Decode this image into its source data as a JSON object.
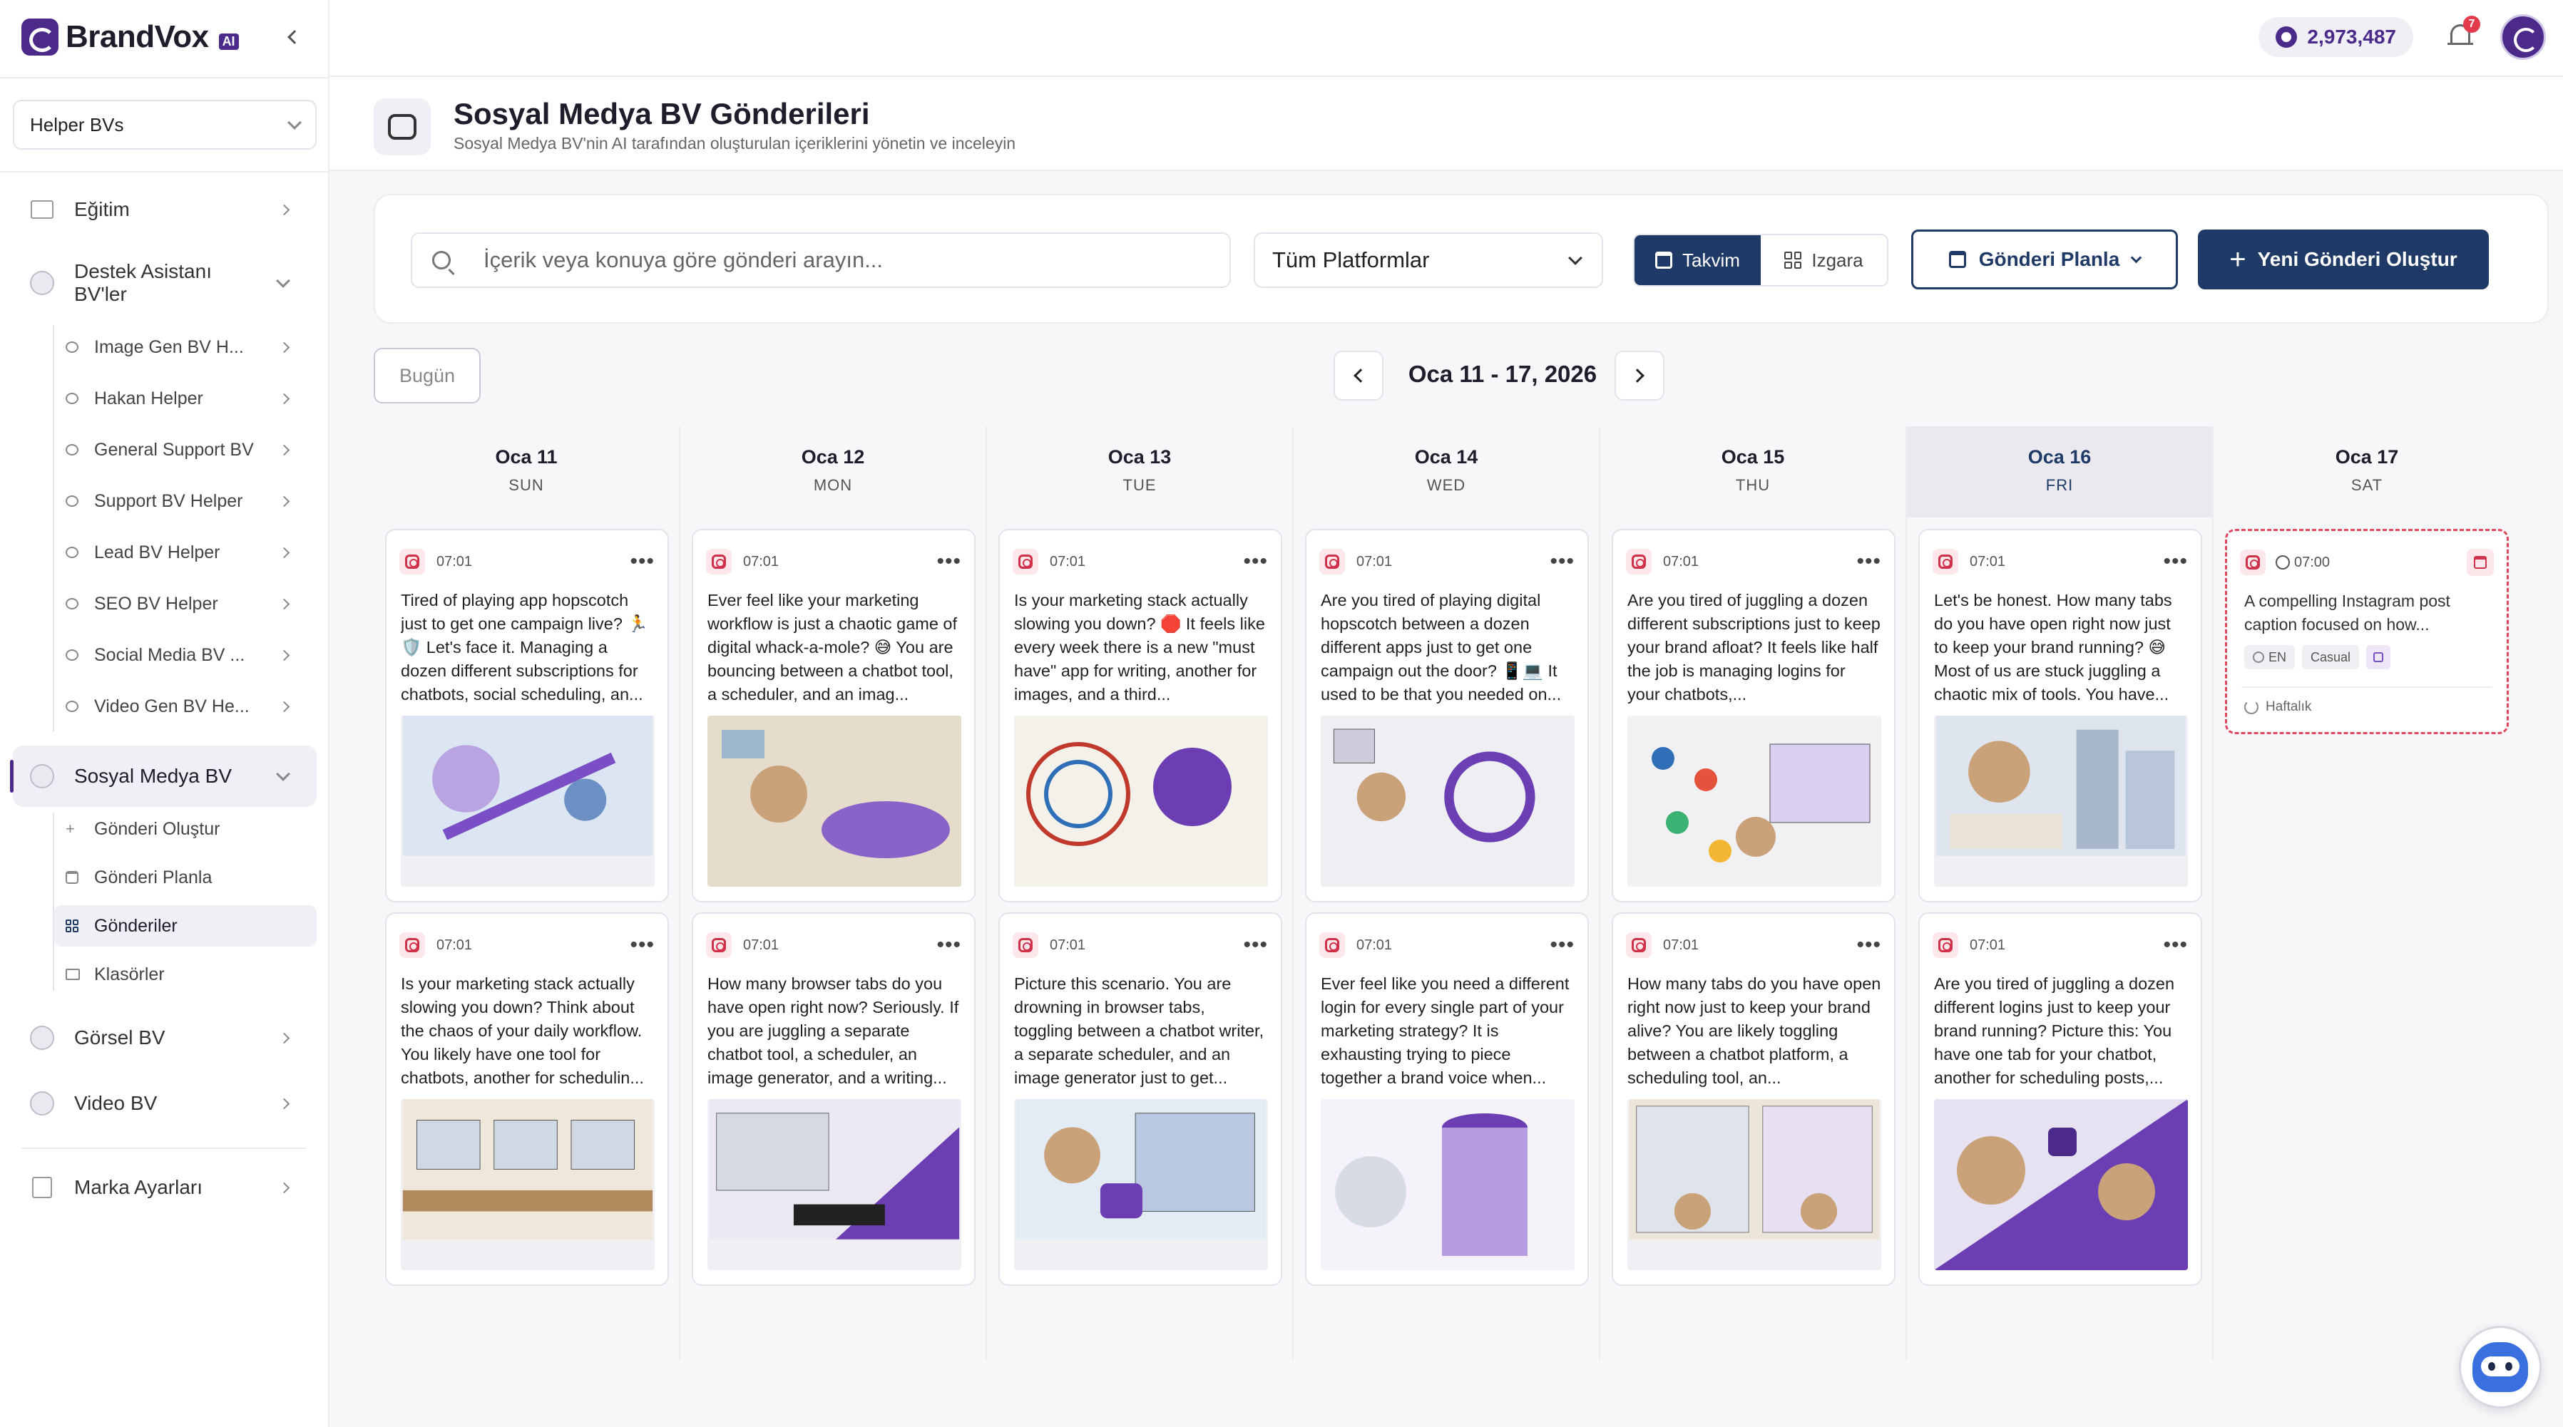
{
  "brand": {
    "name": "BrandVox",
    "badge": "AI",
    "accent": "#4b2a8a"
  },
  "sidebar": {
    "selector": "Helper BVs",
    "items": [
      {
        "label": "Eğitim",
        "icon": "book-icon"
      },
      {
        "label": "Destek Asistanı BV'ler",
        "icon": "bot-icon"
      },
      {
        "label": "Sosyal Medya BV",
        "icon": "bot-icon"
      },
      {
        "label": "Görsel BV",
        "icon": "bot-icon"
      },
      {
        "label": "Video BV",
        "icon": "bot-icon"
      },
      {
        "label": "Marka Ayarları",
        "icon": "building-icon"
      }
    ],
    "support_sub": [
      {
        "label": "Image Gen BV H..."
      },
      {
        "label": "Hakan Helper"
      },
      {
        "label": "General Support BV"
      },
      {
        "label": "Support BV Helper"
      },
      {
        "label": "Lead BV Helper"
      },
      {
        "label": "SEO BV Helper"
      },
      {
        "label": "Social Media BV ..."
      },
      {
        "label": "Video Gen BV He..."
      }
    ],
    "social_sub": [
      {
        "label": "Gönderi Oluştur",
        "icon": "plus-icon"
      },
      {
        "label": "Gönderi Planla",
        "icon": "calendar-icon"
      },
      {
        "label": "Gönderiler",
        "icon": "grid-icon"
      },
      {
        "label": "Klasörler",
        "icon": "folder-icon"
      }
    ]
  },
  "topbar": {
    "credits": "2,973,487",
    "notifications": "7"
  },
  "header": {
    "title": "Sosyal Medya BV Gönderileri",
    "subtitle": "Sosyal Medya BV'nin AI tarafından oluşturulan içeriklerini yönetin ve inceleyin"
  },
  "toolbar": {
    "search_placeholder": "İçerik veya konuya göre gönderi arayın...",
    "platform": "Tüm Platformlar",
    "view_calendar": "Takvim",
    "view_grid": "Izgara",
    "plan_button": "Gönderi Planla",
    "new_button": "Yeni Gönderi Oluştur"
  },
  "calendar_nav": {
    "today": "Bugün",
    "range": "Oca 11 - 17, 2026"
  },
  "days": [
    {
      "date": "Oca 11",
      "day": "SUN",
      "posts": [
        {
          "time": "07:01",
          "text": "Tired of playing app hopscotch just to get one campaign live? 🏃 🛡️ Let's face it. Managing a dozen different subscriptions for chatbots, social scheduling, an..."
        },
        {
          "time": "07:01",
          "text": "Is your marketing stack actually slowing you down? Think about the chaos of your daily workflow. You likely have one tool for chatbots, another for schedulin..."
        }
      ]
    },
    {
      "date": "Oca 12",
      "day": "MON",
      "posts": [
        {
          "time": "07:01",
          "text": "Ever feel like your marketing workflow is just a chaotic game of digital whack-a-mole? 😅 You are bouncing between a chatbot tool, a scheduler, and an imag..."
        },
        {
          "time": "07:01",
          "text": "How many browser tabs do you have open right now? Seriously. If you are juggling a separate chatbot tool, a scheduler, an image generator, and a writing..."
        }
      ]
    },
    {
      "date": "Oca 13",
      "day": "TUE",
      "posts": [
        {
          "time": "07:01",
          "text": "Is your marketing stack actually slowing you down? 🛑 It feels like every week there is a new \"must have\" app for writing, another for images, and a third..."
        },
        {
          "time": "07:01",
          "text": "Picture this scenario. You are drowning in browser tabs, toggling between a chatbot writer, a separate scheduler, and an image generator just to get..."
        }
      ]
    },
    {
      "date": "Oca 14",
      "day": "WED",
      "posts": [
        {
          "time": "07:01",
          "text": "Are you tired of playing digital hopscotch between a dozen different apps just to get one campaign out the door? 📱💻 It used to be that you needed on..."
        },
        {
          "time": "07:01",
          "text": "Ever feel like you need a different login for every single part of your marketing strategy? It is exhausting trying to piece together a brand voice when..."
        }
      ]
    },
    {
      "date": "Oca 15",
      "day": "THU",
      "posts": [
        {
          "time": "07:01",
          "text": "Are you tired of juggling a dozen different subscriptions just to keep your brand afloat? It feels like half the job is managing logins for your chatbots,..."
        },
        {
          "time": "07:01",
          "text": "How many tabs do you have open right now just to keep your brand alive? You are likely toggling between a chatbot platform, a scheduling tool, an..."
        }
      ]
    },
    {
      "date": "Oca 16",
      "day": "FRI",
      "posts": [
        {
          "time": "07:01",
          "text": "Let's be honest. How many tabs do you have open right now just to keep your brand running? 😅 Most of us are stuck juggling a chaotic mix of tools. You have..."
        },
        {
          "time": "07:01",
          "text": "Are you tired of juggling a dozen different logins just to keep your brand running? Picture this: You have one tab for your chatbot, another for scheduling posts,..."
        }
      ]
    },
    {
      "date": "Oca 17",
      "day": "SAT",
      "scheduled": {
        "time": "07:00",
        "text": "A compelling Instagram post caption focused on how...",
        "lang": "EN",
        "tone": "Casual",
        "repeat": "Haftalık"
      }
    }
  ]
}
